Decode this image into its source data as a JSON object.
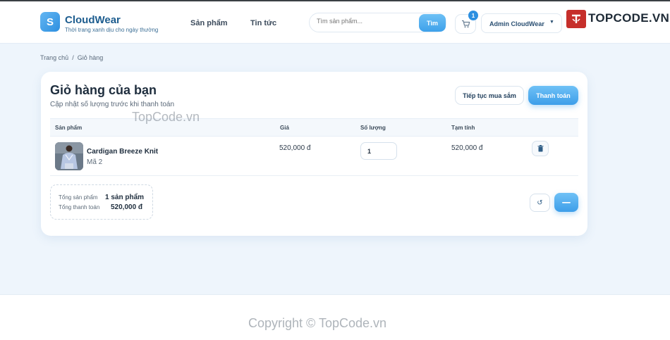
{
  "header": {
    "logo_letter": "S",
    "brand_name": "CloudWear",
    "tagline": "Thời trang xanh dịu cho ngày thường",
    "nav": [
      {
        "label": "Sản phẩm"
      },
      {
        "label": "Tin tức"
      }
    ],
    "search": {
      "placeholder": "Tìm sản phẩm...",
      "button_label": "Tìm"
    },
    "cart_count": "1",
    "user_label": "Admin CloudWear",
    "watermark_logo_text": "TOPCODE.VN"
  },
  "breadcrumb": {
    "home": "Trang chủ",
    "separator": "/",
    "current": "Giỏ hàng"
  },
  "cart": {
    "title": "Giỏ hàng của bạn",
    "subtitle": "Cập nhật số lượng trước khi thanh toán",
    "continue_label": "Tiếp tục mua sắm",
    "checkout_label": "Thanh toán",
    "columns": [
      "Sản phẩm",
      "Giá",
      "Số lượng",
      "Tạm tính"
    ],
    "items": [
      {
        "name": "Cardigan Breeze Knit",
        "code": "Mã 2",
        "price": "520,000 đ",
        "quantity": "1",
        "subtotal": "520,000 đ"
      }
    ],
    "summary": {
      "total_items_label": "Tổng sản phẩm",
      "total_items_value": "1 sản phẩm",
      "total_payment_label": "Tổng thanh toán",
      "total_payment_value": "520,000 đ"
    }
  },
  "watermark": {
    "center_text": "TopCode.vn",
    "copyright_text": "Copyright © TopCode.vn"
  },
  "colors": {
    "accent": "#3d9ee9",
    "brand": "#1d5d8f",
    "background": "#eef5fc"
  }
}
